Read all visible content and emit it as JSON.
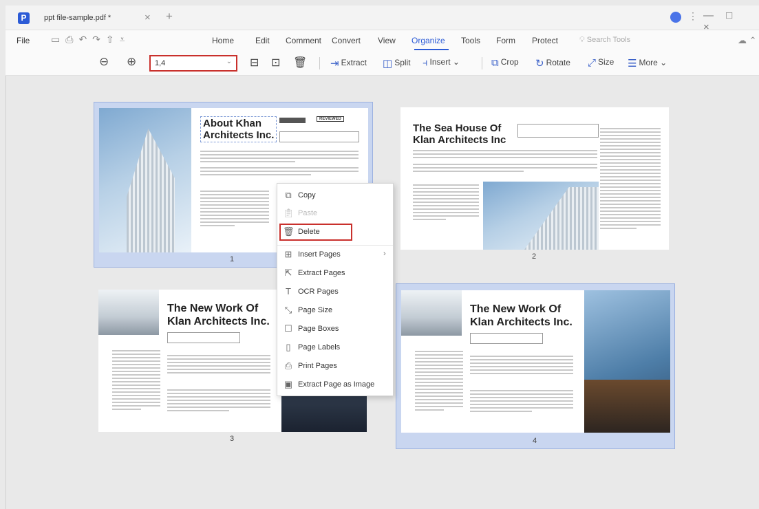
{
  "window": {
    "tab_title": "ppt file-sample.pdf *",
    "tab_close": "×",
    "new_tab": "+",
    "logo_letter": "P",
    "more": "⋮",
    "minimize": "—",
    "maximize": "□",
    "close": "×"
  },
  "menu": {
    "file": "File",
    "tabs": [
      "Home",
      "Edit",
      "Comment",
      "Convert",
      "View",
      "Organize",
      "Tools",
      "Form",
      "Protect"
    ],
    "active_tab": "Organize",
    "search_placeholder": "Search Tools"
  },
  "toolbar": {
    "page_range": "1,4",
    "extract": "Extract",
    "split": "Split",
    "insert": "Insert",
    "crop": "Crop",
    "rotate": "Rotate",
    "size": "Size",
    "more": "More"
  },
  "pages": [
    {
      "number": "1",
      "title_line1": "About Khan",
      "title_line2": "Architects Inc.",
      "badge": "REVIEWED",
      "selected": true
    },
    {
      "number": "2",
      "title_line1": "The Sea House Of",
      "title_line2": "Klan Architects Inc",
      "selected": false
    },
    {
      "number": "3",
      "title_line1": "The New Work Of",
      "title_line2": "Klan Architects Inc.",
      "selected": false
    },
    {
      "number": "4",
      "title_line1": "The New Work Of",
      "title_line2": "Klan Architects Inc.",
      "selected": true
    }
  ],
  "context_menu": {
    "copy": "Copy",
    "paste": "Paste",
    "delete": "Delete",
    "insert_pages": "Insert Pages",
    "extract_pages": "Extract Pages",
    "ocr_pages": "OCR Pages",
    "page_size": "Page Size",
    "page_boxes": "Page Boxes",
    "page_labels": "Page Labels",
    "print_pages": "Print Pages",
    "extract_page_as_image": "Extract Page as Image"
  },
  "colors": {
    "accent": "#2c5bd6",
    "highlight_red": "#c9302c",
    "selection": "#c9d6f0"
  }
}
